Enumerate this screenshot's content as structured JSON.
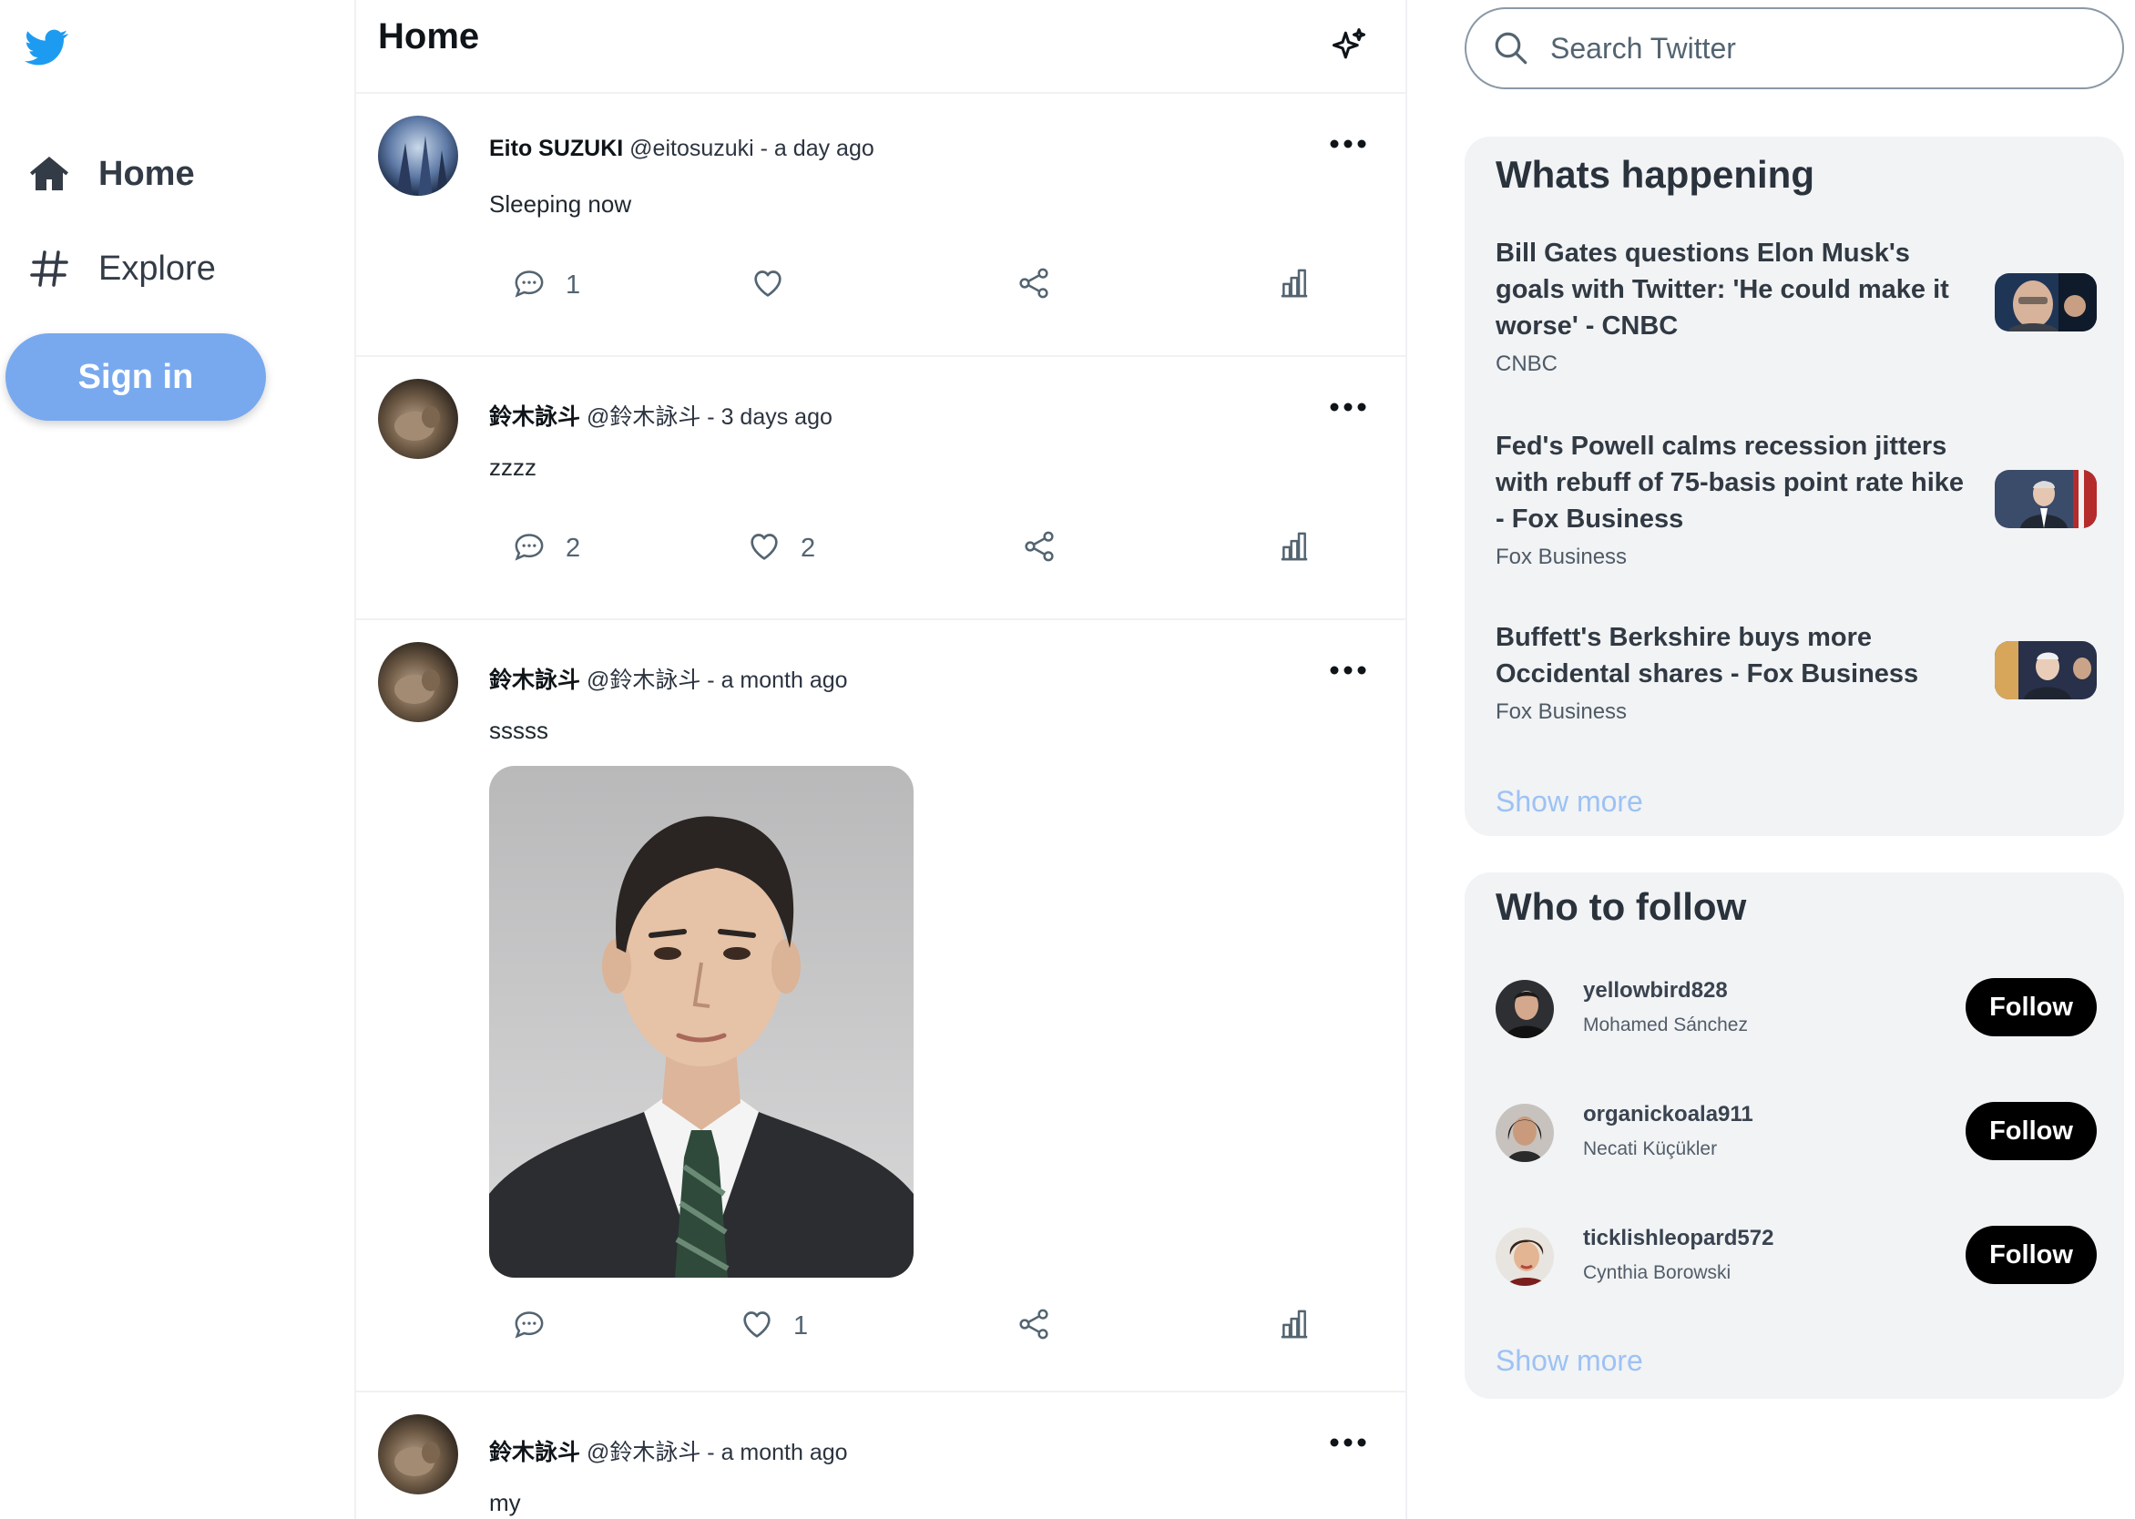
{
  "nav": {
    "items": [
      {
        "label": "Home",
        "icon": "home-icon"
      },
      {
        "label": "Explore",
        "icon": "hashtag-icon"
      }
    ],
    "signin_label": "Sign in"
  },
  "feed": {
    "title": "Home",
    "tweets": [
      {
        "name": "Eito SUZUKI",
        "meta": "@eitosuzuki - a day ago",
        "text": "Sleeping now",
        "replies": "1",
        "likes": ""
      },
      {
        "name": "鈴木詠斗",
        "meta": "@鈴木詠斗 - 3 days ago",
        "text": "zzzz",
        "replies": "2",
        "likes": "2"
      },
      {
        "name": "鈴木詠斗",
        "meta": "@鈴木詠斗 - a month ago",
        "text": "sssss",
        "replies": "",
        "likes": "1"
      },
      {
        "name": "鈴木詠斗",
        "meta": "@鈴木詠斗 - a month ago",
        "text": "my",
        "replies": "",
        "likes": ""
      }
    ]
  },
  "search": {
    "placeholder": "Search Twitter"
  },
  "trends": {
    "title": "Whats happening",
    "items": [
      {
        "title": "Bill Gates questions Elon Musk's goals with Twitter: 'He could make it worse' - CNBC",
        "source": "CNBC"
      },
      {
        "title": "Fed's Powell calms recession jitters with rebuff of 75-basis point rate hike - Fox Business",
        "source": "Fox Business"
      },
      {
        "title": "Buffett's Berkshire buys more Occidental shares - Fox Business",
        "source": "Fox Business"
      }
    ],
    "show_more": "Show more"
  },
  "who_to_follow": {
    "title": "Who to follow",
    "users": [
      {
        "handle": "yellowbird828",
        "name": "Mohamed Sánchez"
      },
      {
        "handle": "organickoala911",
        "name": "Necati Küçükler"
      },
      {
        "handle": "ticklishleopard572",
        "name": "Cynthia Borowski"
      }
    ],
    "follow_label": "Follow",
    "show_more": "Show more"
  },
  "colors": {
    "brand": "#1d9bf0",
    "signin_bg": "#78a9ef",
    "link": "#9dc2f4",
    "panel_bg": "#f1f3f5",
    "follow_bg": "#000000"
  }
}
